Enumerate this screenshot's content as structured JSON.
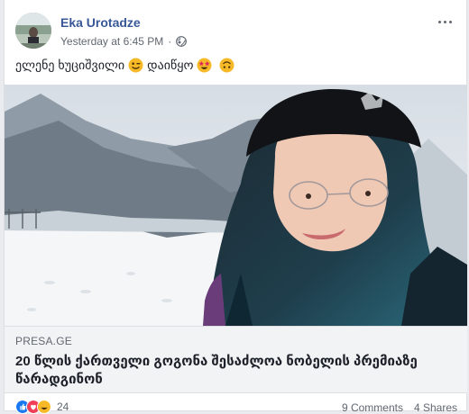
{
  "post": {
    "author": "Eka Urotadze",
    "timestamp": "Yesterday at 6:45 PM",
    "separator": "·",
    "text": "ელენე ხუციშვილი",
    "text2": "დაიწყო"
  },
  "link": {
    "source": "PRESA.GE",
    "headline": "20 წლის ქართველი გოგონა შესაძლოა ნობელის პრემიაზე წარადგინონ"
  },
  "footer": {
    "reaction_count": "24",
    "comments": "9 Comments",
    "shares": "4 Shares"
  },
  "colors": {
    "link_blue": "#385898",
    "secondary_text": "#606770",
    "like_blue": "#1877f2",
    "love_red": "#f33e58",
    "emoji_yellow": "#f7b928"
  },
  "icons": {
    "privacy": "globe-icon",
    "menu": "more-options-icon",
    "reactions": [
      "like-reaction-icon",
      "love-reaction-icon",
      "haha-reaction-icon"
    ]
  }
}
